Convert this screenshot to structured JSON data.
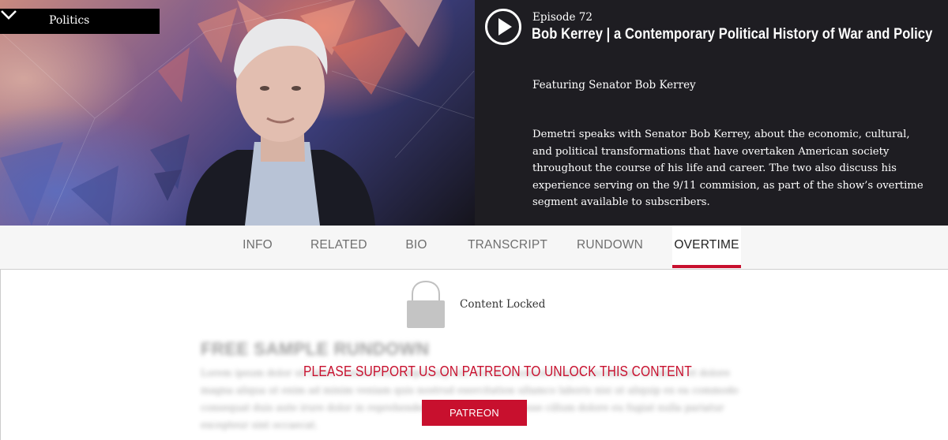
{
  "category": {
    "selected": "Politics",
    "icon": "chevron-down-icon"
  },
  "episode": {
    "number_label": "Episode 72",
    "title": "Bob Kerrey | a Contemporary Political History of War and Policy",
    "featuring": "Featuring Senator Bob Kerrey",
    "description": "Demetri speaks with Senator Bob Kerrey, about the economic, cultural, and political transformations that have overtaken American society throughout the course of his life and career. The two also discuss his experience serving on the 9/11 commision, as part of the show’s overtime segment available to subscribers.",
    "play_icon": "play-circle-icon"
  },
  "tabs": [
    {
      "label": "INFO"
    },
    {
      "label": "RELATED"
    },
    {
      "label": "BIO"
    },
    {
      "label": "TRANSCRIPT"
    },
    {
      "label": "RUNDOWN"
    },
    {
      "label": "OVERTIME",
      "active": true
    }
  ],
  "locked": {
    "icon": "lock-icon",
    "label": "Content Locked",
    "blurred_title": "FREE SAMPLE RUNDOWN",
    "blurred_text": "Lorem ipsum dolor sit amet, consectetur adipiscing elit, sed do eiusmod tempor incididunt ut labore et dolore magna aliqua ut enim ad minim veniam quis nostrud exercitation ullamco laboris nisi ut aliquip ex ea commodo consequat duis aute irure dolor in reprehenderit in voluptate velit esse cillum dolore eu fugiat nulla pariatur excepteur sint occaecat.",
    "message": "PLEASE SUPPORT US ON PATREON TO UNLOCK THIS CONTENT",
    "button_label": "PATREON"
  },
  "colors": {
    "accent": "#c8102e",
    "hero_bg": "#1e1d22",
    "tabbar_bg": "#f6f6f6"
  }
}
